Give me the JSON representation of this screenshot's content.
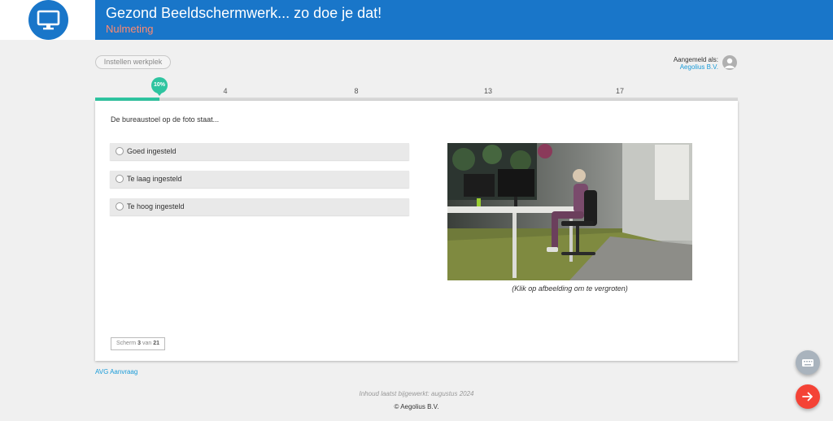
{
  "header": {
    "title": "Gezond Beeldschermwerk... zo doe je dat!",
    "subtitle": "Nulmeting",
    "logo_icon": "monitor-icon",
    "brand_color": "#1976c9"
  },
  "toolbar": {
    "setup_label": "Instellen werkplek"
  },
  "user": {
    "label": "Aangemeld als:",
    "name": "Aegolius B.V.",
    "avatar_icon": "user-icon"
  },
  "progress": {
    "percent_label": "10%",
    "fraction": 0.1,
    "milestones": [
      "4",
      "8",
      "13",
      "17"
    ],
    "color": "#2ec4a0"
  },
  "question": {
    "text": "De bureaustoel op de foto staat...",
    "options": [
      {
        "label": "Goed ingesteld"
      },
      {
        "label": "Te laag ingesteld"
      },
      {
        "label": "Te hoog ingesteld"
      }
    ],
    "photo_caption": "(Klik op afbeelding om te vergroten)"
  },
  "screen_counter": {
    "prefix": "Scherm",
    "current": "3",
    "separator": "van",
    "total": "21"
  },
  "footer": {
    "avg_link": "AVG Aanvraag",
    "updated": "Inhoud laatst bijgewerkt: augustus 2024",
    "copyright": "© Aegolius B.V."
  },
  "fabs": {
    "keyboard_icon": "keyboard-icon",
    "next_icon": "arrow-right-icon",
    "next_color": "#f44336"
  }
}
